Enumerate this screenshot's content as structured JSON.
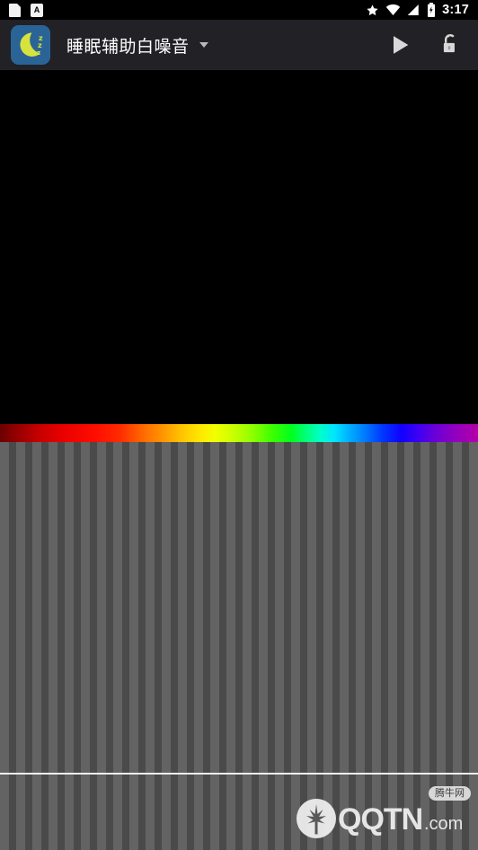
{
  "status_bar": {
    "notifications": [
      {
        "name": "page-notification-icon",
        "label": ""
      },
      {
        "name": "app-notification-icon",
        "label": "A"
      }
    ],
    "icons": [
      "star-icon",
      "wifi-icon",
      "signal-icon",
      "battery-icon"
    ],
    "time": "3:17"
  },
  "app_bar": {
    "app_icon_name": "sleep-moon-app-icon",
    "app_icon_zzz": "zzz",
    "title": "睡眠辅助白噪音",
    "dropdown_icon": "chevron-down-icon",
    "actions": [
      {
        "name": "play-button",
        "label": "play-icon"
      },
      {
        "name": "lock-toggle-button",
        "label": "unlock-icon"
      }
    ]
  },
  "display": {
    "waterfall_label": "waterfall-display",
    "spectrum_label": "color-spectrum-scale",
    "spectrogram_label": "spectrogram-display",
    "cursor_label": "time-cursor-line",
    "colors": {
      "background": "#000000",
      "app_bar": "#212126",
      "stripe_light": "#636363",
      "stripe_dark": "#4a4a4a",
      "accent": "#2a6496",
      "cursor": "#f0f0f0"
    }
  },
  "watermark": {
    "logo_name": "qqtn-bull-logo",
    "brand": "QQTN",
    "suffix": ".com",
    "badge": "腾牛网"
  }
}
